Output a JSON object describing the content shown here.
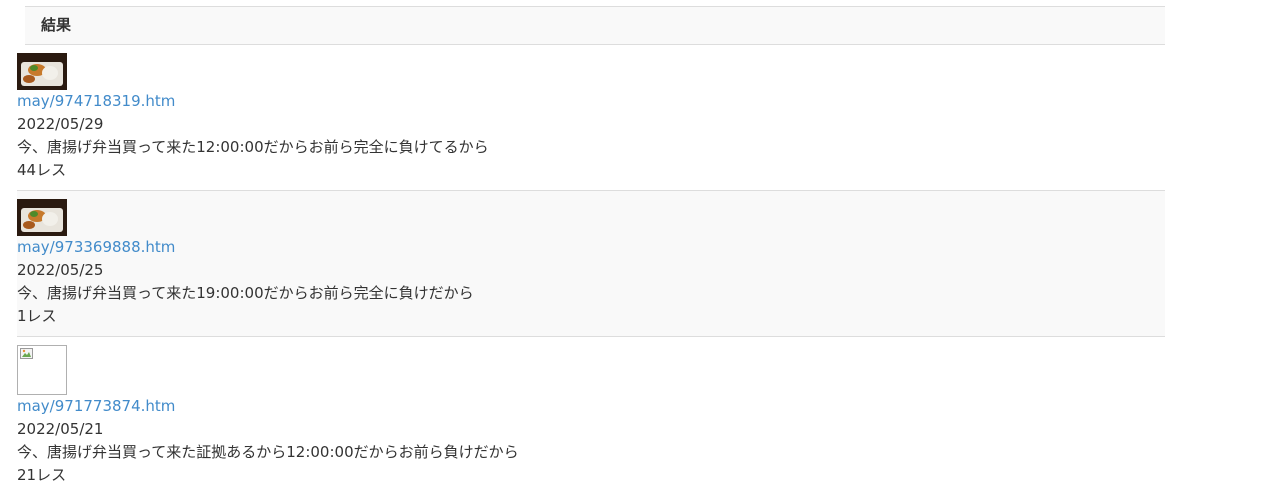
{
  "table": {
    "header": "結果",
    "rows": [
      {
        "link": "may/974718319.htm",
        "date": "2022/05/29",
        "title": "今、唐揚げ弁当買って来た12:00:00だからお前ら完全に負けてるから",
        "replies": "44レス",
        "image": "loaded"
      },
      {
        "link": "may/973369888.htm",
        "date": "2022/05/25",
        "title": "今、唐揚げ弁当買って来た19:00:00だからお前ら完全に負けだから",
        "replies": "1レス",
        "image": "loaded"
      },
      {
        "link": "may/971773874.htm",
        "date": "2022/05/21",
        "title": "今、唐揚げ弁当買って来た証拠あるから12:00:00だからお前ら負けだから",
        "replies": "21レス",
        "image": "broken"
      }
    ]
  },
  "colors": {
    "link": "#428bca",
    "text": "#333333",
    "border": "#dddddd",
    "stripe": "#f9f9f9"
  }
}
